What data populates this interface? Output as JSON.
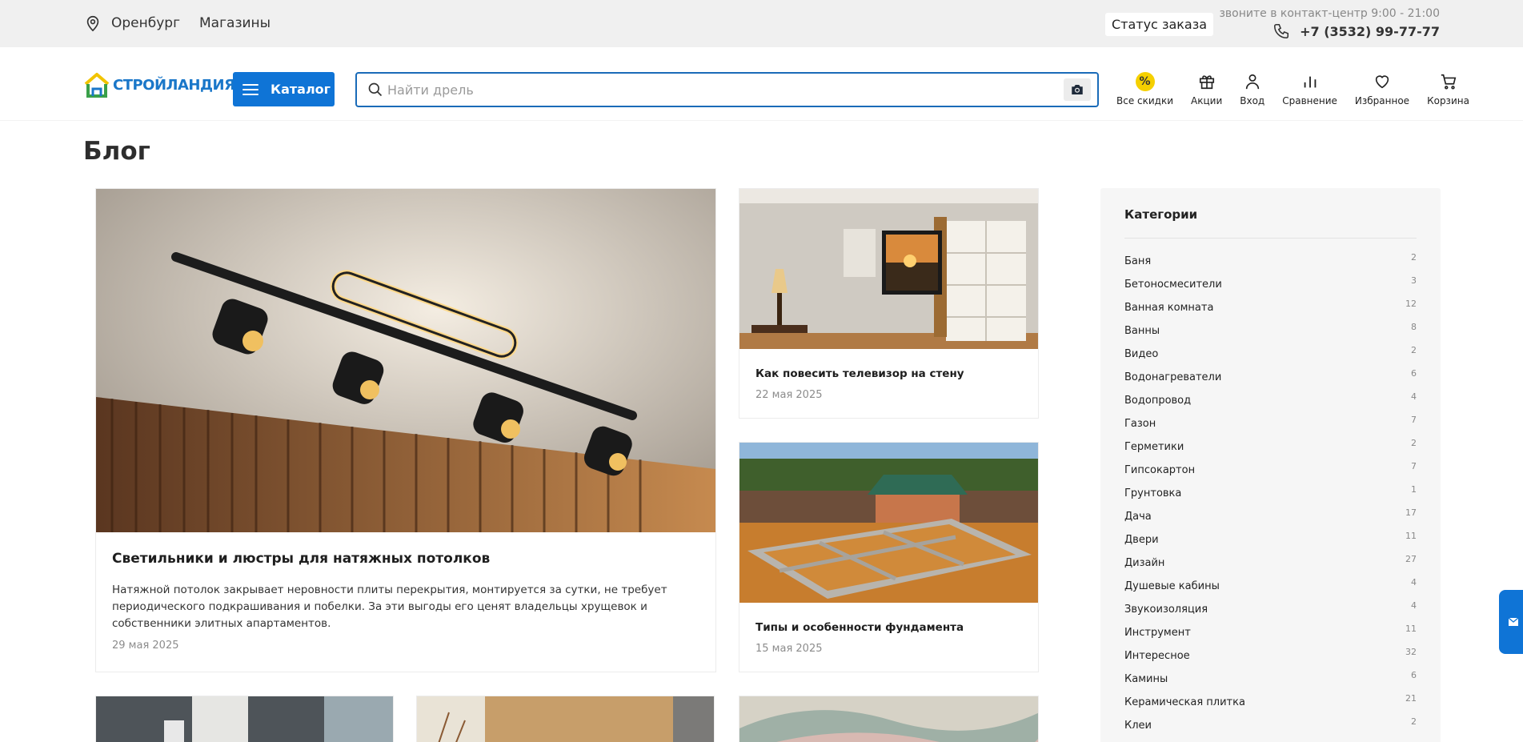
{
  "topbar": {
    "city": "Оренбург",
    "stores": "Магазины",
    "order_status": "Статус заказа",
    "contact_hint": "звоните в контакт-центр 9:00 - 21:00",
    "phone": "+7 (3532) 99-77-77"
  },
  "header": {
    "logo_text": "СТРОЙЛАНДИЯ",
    "catalog_label": "Каталог",
    "search_placeholder": "Найти дрель",
    "icons": [
      {
        "label": "Все скидки",
        "icon": "discount-icon"
      },
      {
        "label": "Акции",
        "icon": "gift-icon"
      },
      {
        "label": "Вход",
        "icon": "user-icon"
      },
      {
        "label": "Сравнение",
        "icon": "compare-icon"
      },
      {
        "label": "Избранное",
        "icon": "heart-icon"
      },
      {
        "label": "Корзина",
        "icon": "cart-icon"
      }
    ]
  },
  "page": {
    "title": "Блог"
  },
  "posts": {
    "featured": {
      "title": "Светильники и люстры для натяжных потолков",
      "description": "Натяжной потолок закрывает неровности плиты перекрытия, монтируется за сутки, не требует периодического подкрашивания и побелки. За эти выгоды его ценят владельцы хрущевок и собственники элитных апартаментов.",
      "date": "29 мая 2025"
    },
    "side": [
      {
        "title": "Как повесить телевизор на стену",
        "date": "22 мая 2025"
      },
      {
        "title": "Типы и особенности фундамента",
        "date": "15 мая 2025"
      }
    ]
  },
  "sidebar": {
    "title": "Категории",
    "categories": [
      {
        "name": "Баня",
        "count": "2"
      },
      {
        "name": "Бетоносмесители",
        "count": "3"
      },
      {
        "name": "Ванная комната",
        "count": "12"
      },
      {
        "name": "Ванны",
        "count": "8"
      },
      {
        "name": "Видео",
        "count": "2"
      },
      {
        "name": "Водонагреватели",
        "count": "6"
      },
      {
        "name": "Водопровод",
        "count": "4"
      },
      {
        "name": "Газон",
        "count": "7"
      },
      {
        "name": "Герметики",
        "count": "2"
      },
      {
        "name": "Гипсокартон",
        "count": "7"
      },
      {
        "name": "Грунтовка",
        "count": "1"
      },
      {
        "name": "Дача",
        "count": "17"
      },
      {
        "name": "Двери",
        "count": "11"
      },
      {
        "name": "Дизайн",
        "count": "27"
      },
      {
        "name": "Душевые кабины",
        "count": "4"
      },
      {
        "name": "Звукоизоляция",
        "count": "4"
      },
      {
        "name": "Инструмент",
        "count": "11"
      },
      {
        "name": "Интересное",
        "count": "32"
      },
      {
        "name": "Камины",
        "count": "6"
      },
      {
        "name": "Керамическая плитка",
        "count": "21"
      },
      {
        "name": "Клеи",
        "count": "2"
      }
    ]
  },
  "colors": {
    "brand_blue": "#0f74d6",
    "search_border": "#1a6bb8",
    "discount_yellow": "#f5d000",
    "topbar_bg": "#f0f0f0"
  }
}
